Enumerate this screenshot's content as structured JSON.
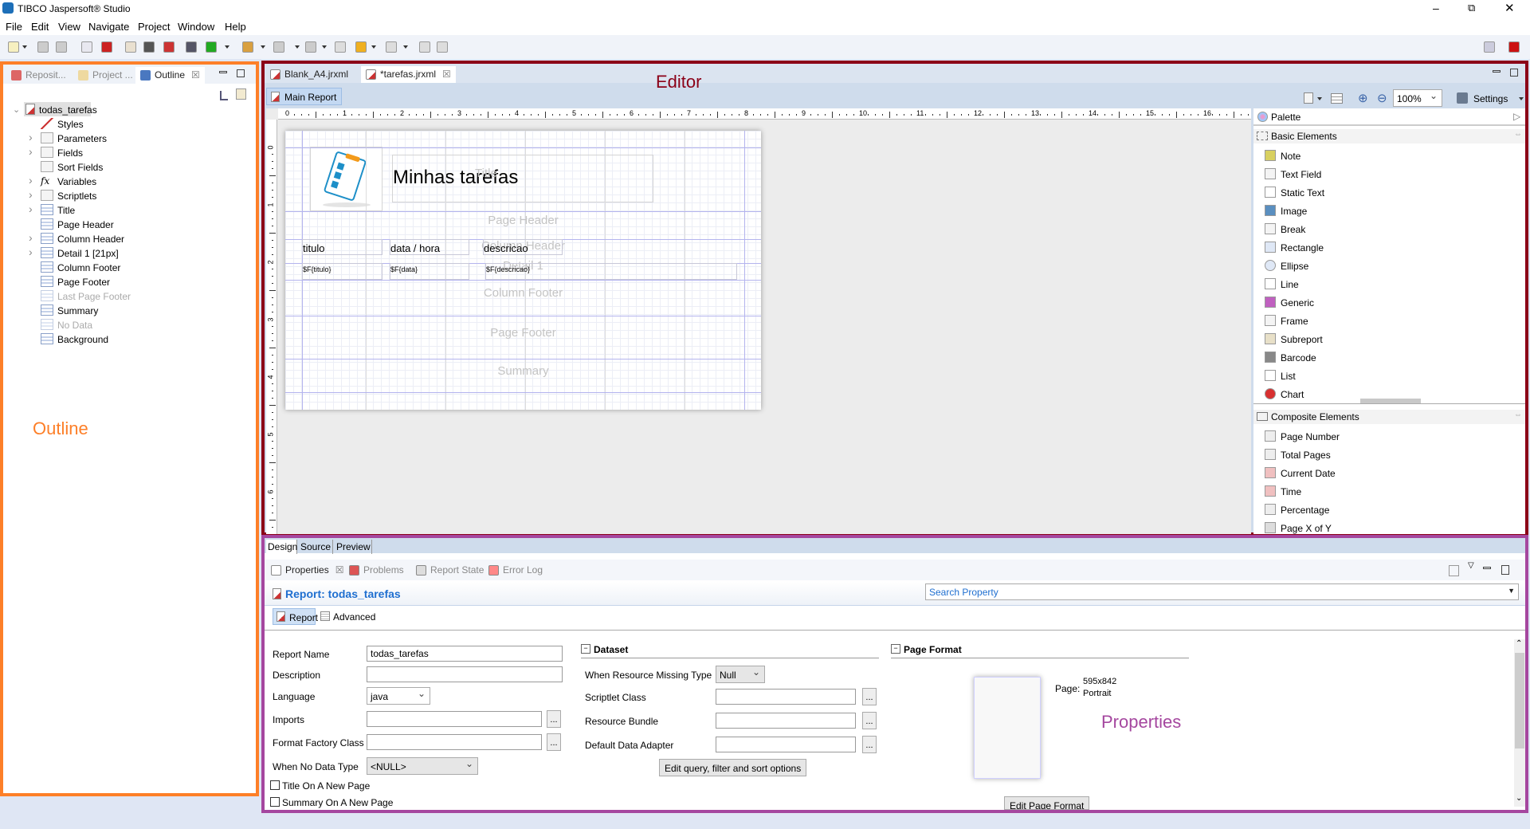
{
  "app": {
    "title": "TIBCO Jaspersoft® Studio"
  },
  "menu": [
    "File",
    "Edit",
    "View",
    "Navigate",
    "Project",
    "Window",
    "Help"
  ],
  "colors": {
    "outline_border": "#fd7f28",
    "editor_border": "#8b0017",
    "properties_border": "#a5479f",
    "link_blue": "#1f6fd0"
  },
  "outline": {
    "tabs": [
      {
        "label": "Reposit...",
        "icon": "repository-icon"
      },
      {
        "label": "Project ...",
        "icon": "project-icon"
      },
      {
        "label": "Outline",
        "icon": "outline-icon",
        "active": true
      }
    ],
    "root": "todas_tarefas",
    "items": [
      {
        "label": "Styles",
        "expandable": false,
        "icon": "styles-brush-icon"
      },
      {
        "label": "Parameters",
        "expandable": true,
        "icon": "parameters-icon"
      },
      {
        "label": "Fields",
        "expandable": true,
        "icon": "fields-icon"
      },
      {
        "label": "Sort Fields",
        "expandable": false,
        "icon": "sort-fields-icon"
      },
      {
        "label": "Variables",
        "expandable": true,
        "icon": "fx-icon"
      },
      {
        "label": "Scriptlets",
        "expandable": true,
        "icon": "coffee-cup-icon"
      },
      {
        "label": "Title",
        "expandable": true,
        "icon": "band-icon"
      },
      {
        "label": "Page Header",
        "expandable": false,
        "icon": "band-icon"
      },
      {
        "label": "Column Header",
        "expandable": true,
        "icon": "band-icon"
      },
      {
        "label": "Detail 1 [21px]",
        "expandable": true,
        "icon": "band-icon"
      },
      {
        "label": "Column Footer",
        "expandable": false,
        "icon": "band-icon"
      },
      {
        "label": "Page Footer",
        "expandable": false,
        "icon": "band-icon"
      },
      {
        "label": "Last Page Footer",
        "expandable": false,
        "icon": "band-icon",
        "disabled": true
      },
      {
        "label": "Summary",
        "expandable": false,
        "icon": "band-icon"
      },
      {
        "label": "No Data",
        "expandable": false,
        "icon": "band-icon",
        "disabled": true
      },
      {
        "label": "Background",
        "expandable": false,
        "icon": "band-icon"
      }
    ],
    "annotation": "Outline"
  },
  "editor": {
    "tabs": [
      {
        "label": "Blank_A4.jrxml"
      },
      {
        "label": "*tarefas.jrxml",
        "active": true
      }
    ],
    "subtab": "Main Report",
    "zoom": "100%",
    "settings": "Settings",
    "annotation": "Editor",
    "ruler": {
      "h": [
        0,
        1,
        2,
        3,
        4,
        5,
        6,
        7,
        8,
        9,
        10,
        11,
        12,
        13,
        14,
        15,
        16
      ],
      "v": [
        0,
        1,
        2,
        3,
        4,
        5,
        6
      ]
    },
    "report": {
      "title_text": "Minhas tarefas",
      "bands": [
        "Title",
        "Page Header",
        "Column Header",
        "Detail 1",
        "Column Footer",
        "Page Footer",
        "Summary"
      ],
      "column_headers": [
        "titulo",
        "data / hora",
        "descricao"
      ],
      "detail_fields": [
        "$F{titulo}",
        "$F{data}",
        "$F{descricao}"
      ]
    },
    "bottom_tabs": [
      "Design",
      "Source",
      "Preview"
    ]
  },
  "palette": {
    "title": "Palette",
    "groups": [
      {
        "name": "Basic Elements",
        "items": [
          {
            "label": "Note",
            "icon": "note-icon",
            "color": "#d8d060"
          },
          {
            "label": "Text Field",
            "icon": "text-field-icon",
            "color": "#f4f4f4"
          },
          {
            "label": "Static Text",
            "icon": "static-text-icon",
            "color": "#ffffff"
          },
          {
            "label": "Image",
            "icon": "image-icon",
            "color": "#5a8fc0"
          },
          {
            "label": "Break",
            "icon": "break-icon",
            "color": "#f4f4f4"
          },
          {
            "label": "Rectangle",
            "icon": "rectangle-icon",
            "color": "#dfe8f6"
          },
          {
            "label": "Ellipse",
            "icon": "ellipse-icon",
            "color": "#dfe8f6"
          },
          {
            "label": "Line",
            "icon": "line-icon",
            "color": "#ffffff"
          },
          {
            "label": "Generic",
            "icon": "generic-icon",
            "color": "#c060c0"
          },
          {
            "label": "Frame",
            "icon": "frame-icon",
            "color": "#f4f4f4"
          },
          {
            "label": "Subreport",
            "icon": "subreport-icon",
            "color": "#e8e0c8"
          },
          {
            "label": "Barcode",
            "icon": "barcode-icon",
            "color": "#888888"
          },
          {
            "label": "List",
            "icon": "list-icon",
            "color": "#ffffff"
          },
          {
            "label": "Chart",
            "icon": "pie-chart-icon",
            "color": "#d83030"
          }
        ]
      },
      {
        "name": "Composite Elements",
        "items": [
          {
            "label": "Page Number",
            "icon": "hash-icon",
            "color": "#eeeeee"
          },
          {
            "label": "Total Pages",
            "icon": "sigma-icon",
            "color": "#eeeeee"
          },
          {
            "label": "Current Date",
            "icon": "calendar-icon",
            "color": "#f0c0c0"
          },
          {
            "label": "Time",
            "icon": "calendar-icon",
            "color": "#f0c0c0"
          },
          {
            "label": "Percentage",
            "icon": "percent-icon",
            "color": "#eeeeee"
          },
          {
            "label": "Page X of Y",
            "icon": "page-x-of-y-icon",
            "color": "#dddddd"
          }
        ]
      }
    ]
  },
  "properties": {
    "tabs": [
      {
        "label": "Properties",
        "active": true
      },
      {
        "label": "Problems"
      },
      {
        "label": "Report State"
      },
      {
        "label": "Error Log"
      }
    ],
    "heading": "Report: todas_tarefas",
    "search_placeholder": "Search Property",
    "subtabs": [
      "Report",
      "Advanced"
    ],
    "form": {
      "report_name_label": "Report Name",
      "report_name": "todas_tarefas",
      "description_label": "Description",
      "description": "",
      "language_label": "Language",
      "language": "java",
      "imports_label": "Imports",
      "imports": "",
      "format_factory_label": "Format Factory Class",
      "format_factory": "",
      "no_data_label": "When No Data Type",
      "no_data": "<NULL>",
      "title_new_page_label": "Title On A New Page",
      "title_new_page": false,
      "summary_new_page_label": "Summary On A New Page",
      "summary_new_page": false,
      "dots": "..."
    },
    "dataset": {
      "heading": "Dataset",
      "resource_missing_label": "When Resource Missing Type",
      "resource_missing": "Null",
      "scriptlet_label": "Scriptlet Class",
      "resource_bundle_label": "Resource Bundle",
      "data_adapter_label": "Default Data Adapter",
      "edit_query_button": "Edit query, filter and sort options"
    },
    "page_format": {
      "heading": "Page Format",
      "page_label": "Page:",
      "size": "595x842",
      "orientation": "Portrait",
      "edit_button": "Edit Page Format"
    },
    "annotation": "Properties"
  }
}
